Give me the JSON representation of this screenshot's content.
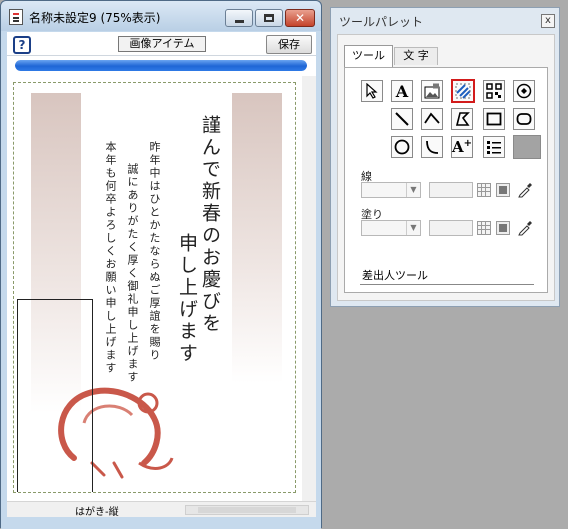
{
  "document_window": {
    "title": "名称未設定9 (75%表示)",
    "toolbar": {
      "help_label": "?",
      "item_label": "画像アイテム",
      "save_label": "保存"
    },
    "progress_fraction": 1.0,
    "card": {
      "title_lines": [
        "謹んで新春のお慶びを",
        "申し上げます"
      ],
      "body_lines": [
        "昨年中はひとかたならぬご厚誼を賜り",
        "誠にありがたく厚く御礼申し上げます",
        "本年も何卒よろしくお願い申し上げます"
      ]
    },
    "status_label": "はがき-縦"
  },
  "palette_window": {
    "title": "ツールパレット",
    "close_label": "x",
    "tabs": [
      {
        "label": "ツール",
        "active": true
      },
      {
        "label": "文 字",
        "active": false
      }
    ],
    "tools_row1": [
      "arrow-icon",
      "text-A-icon",
      "image-icon",
      "clip-icon",
      "qrcode-icon",
      "stamp-icon"
    ],
    "tools_row2": [
      "line-icon",
      "polyline-icon",
      "polygon-icon",
      "rectangle-icon",
      "rounded-rect-icon"
    ],
    "tools_row3": [
      "ellipse-icon",
      "arc-icon",
      "text-add-icon",
      "list-icon",
      "gray-swatch"
    ],
    "selected_tool": "clip-icon",
    "line_label": "線",
    "fill_label": "塗り",
    "tool_name": "差出人ツール"
  }
}
